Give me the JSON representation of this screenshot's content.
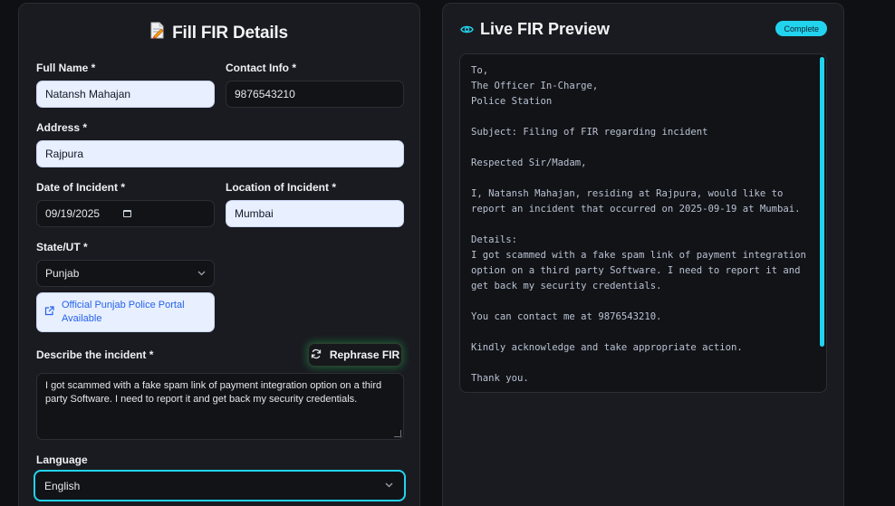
{
  "form": {
    "title": "Fill FIR Details",
    "full_name_label": "Full Name *",
    "full_name_value": "Natansh Mahajan",
    "contact_label": "Contact Info *",
    "contact_value": "9876543210",
    "address_label": "Address *",
    "address_value": "Rajpura",
    "date_label": "Date of Incident *",
    "date_value": "09/19/2025",
    "location_label": "Location of Incident *",
    "location_value": "Mumbai",
    "state_label": "State/UT *",
    "state_value": "Punjab",
    "portal_link": "Official Punjab Police Portal Available",
    "describe_label": "Describe the incident *",
    "rephrase_button": "Rephrase FIR",
    "description_value": "I got scammed with a fake spam link of payment integration option on a third party Software. I need to report it and get back my security credentials.",
    "language_label": "Language",
    "language_value": "English"
  },
  "preview": {
    "title": "Live FIR Preview",
    "status_badge": "Complete",
    "body": "To,\nThe Officer In-Charge,\nPolice Station\n\nSubject: Filing of FIR regarding incident\n\nRespected Sir/Madam,\n\nI, Natansh Mahajan, residing at Rajpura, would like to report an incident that occurred on 2025-09-19 at Mumbai.\n\nDetails:\nI got scammed with a fake spam link of payment integration option on a third party Software. I need to report it and get back my security credentials.\n\nYou can contact me at 9876543210.\n\nKindly acknowledge and take appropriate action.\n\nThank you."
  },
  "icons": {
    "form_title_icon": "document-pencil-icon",
    "preview_title_icon": "eye-icon",
    "portal_icon": "external-link-icon",
    "rephrase_icon": "refresh-icon",
    "select_icon": "chevron-down-icon",
    "date_icon": "calendar-icon"
  },
  "colors": {
    "accent": "#22d3ee",
    "link": "#2563eb",
    "glow": "#22c55e"
  }
}
